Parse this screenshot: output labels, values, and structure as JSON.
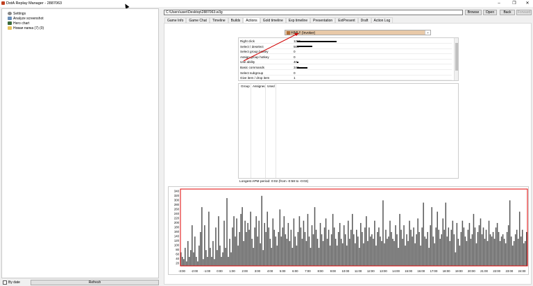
{
  "window": {
    "title": "DotA Replay Manager - 2887063",
    "controls": [
      "–",
      "❐",
      "✕"
    ]
  },
  "tree": {
    "items": [
      {
        "label": "Settings",
        "icon": "gear-icon"
      },
      {
        "label": "Analyze screenshot",
        "icon": "screenshot-icon"
      },
      {
        "label": "Hero chart",
        "icon": "chart-icon"
      },
      {
        "label": "Новая папка (7) (0)",
        "icon": "folder-icon"
      }
    ]
  },
  "bottom": {
    "by_date": "By date",
    "refresh": "Refresh"
  },
  "toolbar": {
    "path": "C:\\Users\\user\\Desktop\\2887063.w3g",
    "browse": "Browse",
    "open": "Open",
    "back": "Back",
    "forward": "Forward"
  },
  "tabs": [
    "Game Info",
    "Game Chat",
    "Timeline",
    "Builds",
    "Actions",
    "Gold timeline",
    "Exp timeline",
    "Presentation",
    "ExtPresent",
    "Draft",
    "Action Log"
  ],
  "active_tab": "Actions",
  "player_select": {
    "label": "HIMU! (Invoker)",
    "arrow": "⌄"
  },
  "actions_table": {
    "rows": [
      {
        "name": "Right click",
        "value": "1291",
        "bar_fraction": 1.0
      },
      {
        "name": "Select / deselect",
        "value": "500",
        "bar_fraction": 0.38
      },
      {
        "name": "Select group hotkey",
        "value": "0",
        "bar_fraction": 0
      },
      {
        "name": "Assign group hotkey",
        "value": "0",
        "bar_fraction": 0
      },
      {
        "name": "Use ability",
        "value": "40",
        "bar_fraction": 0.03
      },
      {
        "name": "Basic commands",
        "value": "340",
        "bar_fraction": 0.26
      },
      {
        "name": "Select subgroup",
        "value": "0",
        "bar_fraction": 0
      },
      {
        "name": "Give item / drop item",
        "value": "1",
        "bar_fraction": 0
      }
    ]
  },
  "groups_table": {
    "headers": [
      "Group",
      "Assigned",
      "Used"
    ]
  },
  "apm_text": "Longest APM period: 0:02 (from -0:58 to -0:03)",
  "colors": {
    "chart_border": "#e00000",
    "annotation_arrow": "#d00000",
    "bars": "#555555"
  },
  "chart_data": {
    "type": "bar",
    "y_ticks": [
      "340",
      "320",
      "300",
      "280",
      "260",
      "240",
      "220",
      "200",
      "180",
      "160",
      "140",
      "120",
      "100",
      "80",
      "60",
      "40",
      "20"
    ],
    "x_ticks": [
      "-3:00",
      "-2:00",
      "-1:00",
      "0:00",
      "1:00",
      "2:00",
      "3:00",
      "4:00",
      "5:00",
      "6:00",
      "7:00",
      "8:00",
      "9:00",
      "10:00",
      "11:00",
      "12:00",
      "13:00",
      "14:00",
      "15:00",
      "16:00",
      "17:00",
      "18:00",
      "19:00",
      "20:00",
      "21:00",
      "22:00",
      "23:00",
      "24:00"
    ],
    "ylim": [
      0,
      340
    ],
    "values": [
      60,
      40,
      30,
      80,
      20,
      110,
      40,
      70,
      180,
      60,
      130,
      40,
      20,
      90,
      150,
      260,
      30,
      180,
      70,
      40,
      240,
      80,
      40,
      110,
      30,
      170,
      70,
      220,
      90,
      40,
      60,
      200,
      80,
      300,
      40,
      120,
      60,
      170,
      220,
      130,
      210,
      90,
      150,
      230,
      260,
      110,
      200,
      150,
      190,
      160,
      240,
      120,
      80,
      170,
      220,
      130,
      200,
      100,
      310,
      70,
      190,
      150,
      240,
      170,
      120,
      80,
      210,
      160,
      130,
      90,
      150,
      250,
      130,
      170,
      220,
      140,
      120,
      190,
      110,
      160,
      80,
      210,
      130,
      90,
      150,
      220,
      170,
      120,
      200,
      150,
      110,
      230,
      130,
      80,
      180,
      140,
      260,
      160,
      120,
      80,
      190,
      140,
      110,
      170,
      210,
      120,
      160,
      90,
      140,
      230,
      170,
      120,
      90,
      150,
      190,
      120,
      100,
      180,
      140,
      90,
      200,
      120,
      160,
      230,
      140,
      100,
      160,
      130,
      80,
      190,
      150,
      100,
      170,
      220,
      110,
      170,
      130,
      140,
      120,
      200,
      90,
      150,
      170,
      130,
      110,
      290,
      100,
      160,
      120,
      130,
      200,
      150,
      120,
      110,
      180,
      140,
      80,
      230,
      160,
      120,
      180,
      90,
      140,
      110,
      200,
      160,
      130,
      170,
      100,
      140,
      210,
      150,
      90,
      170,
      280,
      130,
      120,
      150,
      80,
      180,
      260,
      130,
      100,
      170,
      240,
      160,
      120,
      140,
      210,
      160,
      280,
      130,
      170,
      110,
      160,
      200,
      140,
      60,
      190,
      120,
      90,
      150,
      200,
      170,
      130,
      110,
      160,
      190,
      120,
      140,
      230,
      170,
      100,
      150,
      180,
      210,
      140,
      170,
      120,
      160,
      110,
      200,
      140,
      130,
      150,
      120,
      170,
      190,
      150,
      110,
      130,
      140,
      120,
      100,
      150,
      180,
      290,
      130,
      90,
      110,
      140,
      160,
      120,
      240,
      130,
      160,
      100,
      110,
      150
    ]
  }
}
